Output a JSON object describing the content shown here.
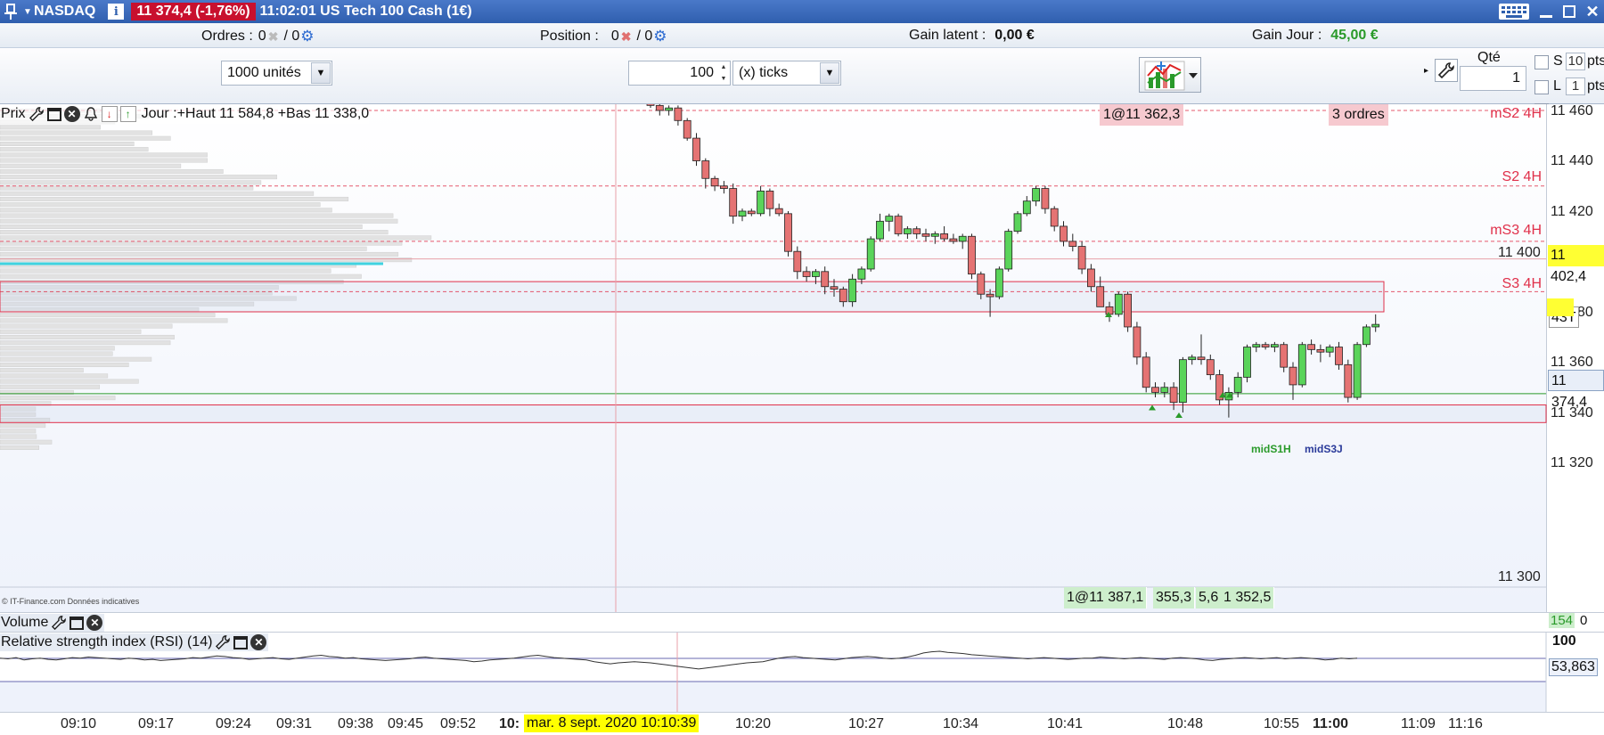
{
  "titlebar": {
    "instrument": "NASDAQ",
    "price_change": "11 374,4 (-1,76%)",
    "description": "11:02:01 US Tech 100 Cash (1€)"
  },
  "infostrip": {
    "orders_label": "Ordres :",
    "orders_a": "0",
    "orders_b": "/ 0",
    "position_label": "Position :",
    "position_a": "0",
    "position_b": "/ 0",
    "gain_latent_label": "Gain latent :",
    "gain_latent_value": "0,00 €",
    "gain_jour_label": "Gain Jour :",
    "gain_jour_value": "45,00 €"
  },
  "toolbar": {
    "units_select": "1000 unités",
    "ticks_value": "100",
    "ticks_select": "(x) ticks",
    "qty_label": "Qté",
    "qty_value": "1",
    "s_label": "S",
    "s_pts": "10",
    "l_label": "L",
    "l_pts": "1",
    "pts_label": "pts"
  },
  "chart": {
    "price_label": "Prix",
    "day_range": "Jour :+Haut 11 584,8 +Bas 11 338,0",
    "level_labels": [
      "mS2 4H",
      "S2 4H",
      "mS3 4H",
      "S3 4H"
    ],
    "axis_ticks": [
      "11 460",
      "11 440",
      "11 420",
      "11 400",
      "11 380",
      "11 360",
      "11 340",
      "11 320",
      "11 300"
    ],
    "order_tag": "1@11 362,3",
    "orders_count_tag": "3 ordres",
    "flag_price": "11 402,4",
    "flag_last": "11 374,4",
    "flag_timer": "43T",
    "bottom_tags": [
      "1@11 387,1",
      "355,3",
      "5,6",
      "1 352,5"
    ],
    "pivot_labels": [
      "midS1H",
      "midS3J"
    ],
    "source_note": "© IT-Finance.com  Données indicatives",
    "colors": {
      "bull": "#5ad45a",
      "bear": "#e57373",
      "level_red": "#e0304a",
      "support_line": "#2a9a2a",
      "cyan_line": "#3fd3e0"
    }
  },
  "volume": {
    "label": "Volume",
    "value": "154"
  },
  "rsi": {
    "label": "Relative strength index (RSI) (14)",
    "level_100": "100",
    "value": "53,863"
  },
  "time_axis": {
    "ticks": [
      "09:10",
      "09:17",
      "09:24",
      "09:31",
      "09:38",
      "09:45",
      "09:52",
      "10:",
      "10:20",
      "10:27",
      "10:34",
      "10:41",
      "10:48",
      "10:55",
      "11:00",
      "11:09",
      "11:16"
    ],
    "cursor_date": "mar. 8 sept. 2020 10:10:39"
  },
  "chart_data": {
    "type": "candlestick",
    "ylim": [
      11290,
      11466
    ],
    "candles": [
      {
        "o": 11464,
        "h": 11466,
        "l": 11461,
        "c": 11462
      },
      {
        "o": 11462,
        "h": 11464,
        "l": 11458,
        "c": 11460
      },
      {
        "o": 11460,
        "h": 11462,
        "l": 11458,
        "c": 11461
      },
      {
        "o": 11461,
        "h": 11462,
        "l": 11454,
        "c": 11456
      },
      {
        "o": 11456,
        "h": 11457,
        "l": 11448,
        "c": 11449
      },
      {
        "o": 11449,
        "h": 11451,
        "l": 11438,
        "c": 11440
      },
      {
        "o": 11440,
        "h": 11441,
        "l": 11429,
        "c": 11433
      },
      {
        "o": 11433,
        "h": 11434,
        "l": 11428,
        "c": 11430
      },
      {
        "o": 11430,
        "h": 11432,
        "l": 11427,
        "c": 11429
      },
      {
        "o": 11429,
        "h": 11431,
        "l": 11415,
        "c": 11418
      },
      {
        "o": 11418,
        "h": 11421,
        "l": 11416,
        "c": 11420
      },
      {
        "o": 11420,
        "h": 11421,
        "l": 11418,
        "c": 11419
      },
      {
        "o": 11419,
        "h": 11430,
        "l": 11418,
        "c": 11428
      },
      {
        "o": 11428,
        "h": 11429,
        "l": 11418,
        "c": 11421
      },
      {
        "o": 11421,
        "h": 11423,
        "l": 11418,
        "c": 11419
      },
      {
        "o": 11419,
        "h": 11420,
        "l": 11402,
        "c": 11404
      },
      {
        "o": 11404,
        "h": 11406,
        "l": 11393,
        "c": 11396
      },
      {
        "o": 11396,
        "h": 11398,
        "l": 11392,
        "c": 11394
      },
      {
        "o": 11394,
        "h": 11397,
        "l": 11391,
        "c": 11396
      },
      {
        "o": 11396,
        "h": 11398,
        "l": 11387,
        "c": 11390
      },
      {
        "o": 11390,
        "h": 11393,
        "l": 11386,
        "c": 11389
      },
      {
        "o": 11389,
        "h": 11390,
        "l": 11382,
        "c": 11384
      },
      {
        "o": 11384,
        "h": 11395,
        "l": 11382,
        "c": 11393
      },
      {
        "o": 11393,
        "h": 11398,
        "l": 11391,
        "c": 11397
      },
      {
        "o": 11397,
        "h": 11410,
        "l": 11396,
        "c": 11409
      },
      {
        "o": 11409,
        "h": 11419,
        "l": 11408,
        "c": 11416
      },
      {
        "o": 11416,
        "h": 11419,
        "l": 11412,
        "c": 11418
      },
      {
        "o": 11418,
        "h": 11419,
        "l": 11410,
        "c": 11411
      },
      {
        "o": 11411,
        "h": 11414,
        "l": 11409,
        "c": 11413
      },
      {
        "o": 11413,
        "h": 11414,
        "l": 11409,
        "c": 11411
      },
      {
        "o": 11411,
        "h": 11413,
        "l": 11408,
        "c": 11410
      },
      {
        "o": 11410,
        "h": 11412,
        "l": 11407,
        "c": 11411
      },
      {
        "o": 11411,
        "h": 11414,
        "l": 11408,
        "c": 11409
      },
      {
        "o": 11409,
        "h": 11411,
        "l": 11407,
        "c": 11408
      },
      {
        "o": 11408,
        "h": 11411,
        "l": 11405,
        "c": 11410
      },
      {
        "o": 11410,
        "h": 11411,
        "l": 11393,
        "c": 11395
      },
      {
        "o": 11395,
        "h": 11396,
        "l": 11385,
        "c": 11387
      },
      {
        "o": 11387,
        "h": 11389,
        "l": 11378,
        "c": 11386
      },
      {
        "o": 11386,
        "h": 11398,
        "l": 11385,
        "c": 11397
      },
      {
        "o": 11397,
        "h": 11413,
        "l": 11396,
        "c": 11412
      },
      {
        "o": 11412,
        "h": 11420,
        "l": 11411,
        "c": 11419
      },
      {
        "o": 11419,
        "h": 11426,
        "l": 11418,
        "c": 11424
      },
      {
        "o": 11424,
        "h": 11430,
        "l": 11422,
        "c": 11429
      },
      {
        "o": 11429,
        "h": 11430,
        "l": 11419,
        "c": 11421
      },
      {
        "o": 11421,
        "h": 11422,
        "l": 11412,
        "c": 11414
      },
      {
        "o": 11414,
        "h": 11416,
        "l": 11406,
        "c": 11408
      },
      {
        "o": 11408,
        "h": 11411,
        "l": 11404,
        "c": 11406
      },
      {
        "o": 11406,
        "h": 11408,
        "l": 11395,
        "c": 11397
      },
      {
        "o": 11397,
        "h": 11399,
        "l": 11388,
        "c": 11390
      },
      {
        "o": 11390,
        "h": 11394,
        "l": 11384,
        "c": 11382
      },
      {
        "o": 11382,
        "h": 11384,
        "l": 11376,
        "c": 11379
      },
      {
        "o": 11379,
        "h": 11388,
        "l": 11378,
        "c": 11387
      },
      {
        "o": 11387,
        "h": 11388,
        "l": 11372,
        "c": 11374
      },
      {
        "o": 11374,
        "h": 11376,
        "l": 11359,
        "c": 11362
      },
      {
        "o": 11362,
        "h": 11364,
        "l": 11348,
        "c": 11350
      },
      {
        "o": 11350,
        "h": 11352,
        "l": 11346,
        "c": 11348
      },
      {
        "o": 11348,
        "h": 11352,
        "l": 11346,
        "c": 11350
      },
      {
        "o": 11350,
        "h": 11352,
        "l": 11341,
        "c": 11344
      },
      {
        "o": 11344,
        "h": 11362,
        "l": 11340,
        "c": 11361
      },
      {
        "o": 11361,
        "h": 11363,
        "l": 11359,
        "c": 11362
      },
      {
        "o": 11362,
        "h": 11371,
        "l": 11359,
        "c": 11361
      },
      {
        "o": 11361,
        "h": 11363,
        "l": 11353,
        "c": 11355
      },
      {
        "o": 11355,
        "h": 11357,
        "l": 11343,
        "c": 11345
      },
      {
        "o": 11345,
        "h": 11350,
        "l": 11338,
        "c": 11348
      },
      {
        "o": 11348,
        "h": 11356,
        "l": 11346,
        "c": 11354
      },
      {
        "o": 11354,
        "h": 11367,
        "l": 11352,
        "c": 11366
      },
      {
        "o": 11366,
        "h": 11368,
        "l": 11364,
        "c": 11367
      },
      {
        "o": 11367,
        "h": 11368,
        "l": 11365,
        "c": 11366
      },
      {
        "o": 11366,
        "h": 11368,
        "l": 11364,
        "c": 11367
      },
      {
        "o": 11367,
        "h": 11368,
        "l": 11356,
        "c": 11358
      },
      {
        "o": 11358,
        "h": 11360,
        "l": 11345,
        "c": 11351
      },
      {
        "o": 11351,
        "h": 11368,
        "l": 11350,
        "c": 11367
      },
      {
        "o": 11367,
        "h": 11369,
        "l": 11363,
        "c": 11365
      },
      {
        "o": 11365,
        "h": 11367,
        "l": 11360,
        "c": 11364
      },
      {
        "o": 11364,
        "h": 11367,
        "l": 11362,
        "c": 11366
      },
      {
        "o": 11366,
        "h": 11368,
        "l": 11357,
        "c": 11359
      },
      {
        "o": 11359,
        "h": 11361,
        "l": 11344,
        "c": 11346
      },
      {
        "o": 11346,
        "h": 11368,
        "l": 11345,
        "c": 11367
      },
      {
        "o": 11367,
        "h": 11375,
        "l": 11366,
        "c": 11374
      },
      {
        "o": 11374,
        "h": 11379,
        "l": 11372,
        "c": 11375
      }
    ],
    "levels": [
      {
        "name": "mS2 4H",
        "price": 11460
      },
      {
        "name": "S2 4H",
        "price": 11430
      },
      {
        "name": "mS3 4H",
        "price": 11408
      },
      {
        "name": "S3 4H",
        "price": 11388
      }
    ],
    "rsi_values": [
      58,
      57,
      59,
      55,
      57,
      58,
      56,
      55,
      57,
      59,
      58,
      60,
      59,
      58,
      57,
      56,
      58,
      57,
      55,
      56,
      54,
      55,
      56,
      57,
      59,
      58,
      60,
      62,
      61,
      59,
      58,
      56,
      57,
      58,
      59,
      57,
      56,
      58,
      60,
      62,
      63,
      61,
      60,
      58,
      59,
      57,
      56,
      55,
      54,
      55,
      56,
      57,
      59,
      60,
      58,
      57,
      56,
      55,
      54,
      52,
      53,
      55,
      56,
      57,
      58,
      60,
      62,
      63,
      61,
      59,
      58,
      57,
      56,
      55,
      52,
      50,
      49,
      50,
      51,
      52,
      51,
      50,
      49,
      48,
      47,
      46,
      45,
      44,
      45,
      46,
      47,
      48,
      49,
      50,
      51,
      52,
      55,
      58,
      60,
      61,
      59,
      58,
      57,
      56,
      55,
      57,
      59,
      60,
      61,
      60,
      58,
      57,
      58,
      60,
      63,
      67,
      69,
      70,
      68,
      67,
      66,
      64,
      63,
      62,
      61,
      60,
      59,
      58,
      57,
      58,
      59,
      58,
      57,
      56,
      57,
      58,
      58,
      60,
      59,
      58,
      57,
      58,
      59,
      58,
      57,
      56,
      58,
      59,
      58,
      57,
      55,
      54,
      56,
      57,
      58,
      59,
      58,
      57,
      58,
      59,
      57,
      58,
      59,
      58,
      57,
      55,
      56,
      58,
      57,
      58
    ]
  }
}
